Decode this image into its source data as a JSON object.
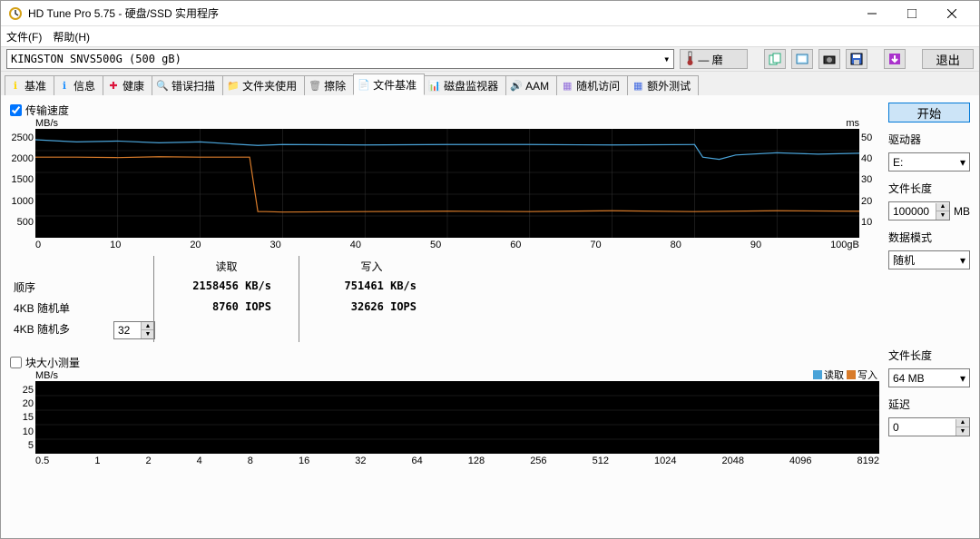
{
  "window": {
    "title": "HD Tune Pro 5.75 - 硬盘/SSD 实用程序"
  },
  "menu": {
    "file": "文件(F)",
    "help": "帮助(H)"
  },
  "toolbar": {
    "drive": "KINGSTON SNVS500G (500 gB)",
    "temp_dash": "— 磨",
    "exit": "退出"
  },
  "tabs": [
    {
      "label": "基准",
      "icon": "ℹ",
      "color": "#FFD700"
    },
    {
      "label": "信息",
      "icon": "ℹ",
      "color": "#1E90FF"
    },
    {
      "label": "健康",
      "icon": "✚",
      "color": "#DC143C"
    },
    {
      "label": "错误扫描",
      "icon": "🔍",
      "color": "#228B22"
    },
    {
      "label": "文件夹使用",
      "icon": "📁",
      "color": "#DAA520"
    },
    {
      "label": "擦除",
      "icon": "🗑",
      "color": "#808080"
    },
    {
      "label": "文件基准",
      "icon": "📄",
      "color": "#4169E1",
      "active": true
    },
    {
      "label": "磁盘监视器",
      "icon": "📊",
      "color": "#228B22"
    },
    {
      "label": "AAM",
      "icon": "🔊",
      "color": "#1E90FF"
    },
    {
      "label": "随机访问",
      "icon": "▦",
      "color": "#9370DB"
    },
    {
      "label": "额外测试",
      "icon": "▦",
      "color": "#4169E1"
    }
  ],
  "section1": {
    "chk": "传输速度",
    "unit_left": "MB/s",
    "unit_right": "ms",
    "read_hdr": "读取",
    "write_hdr": "写入",
    "rows": [
      {
        "label": "顺序",
        "spin": "",
        "read": "2158456 KB/s",
        "write": "751461 KB/s"
      },
      {
        "label": "4KB 随机单",
        "spin": "",
        "read": "8760 IOPS",
        "write": "32626 IOPS"
      },
      {
        "label": "4KB 随机多",
        "spin": "32",
        "read": "",
        "write": ""
      }
    ]
  },
  "section2": {
    "chk": "块大小测量",
    "unit": "MB/s",
    "legend_read": "读取",
    "legend_write": "写入"
  },
  "sidebar": {
    "start": "开始",
    "drive_label": "驱动器",
    "drive": "E:",
    "filelen_label": "文件长度",
    "filelen": "100000",
    "filelen_unit": "MB",
    "datamode_label": "数据模式",
    "datamode": "随机",
    "filelen2_label": "文件长度",
    "filelen2": "64 MB",
    "delay_label": "延迟",
    "delay": "0"
  },
  "chart_data": {
    "transfer": {
      "type": "line",
      "xlabel": "",
      "ylabel_left": "MB/s",
      "ylabel_right": "ms",
      "x_range": [
        0,
        100
      ],
      "x_unit": "gB",
      "y_left_ticks": [
        500,
        1000,
        1500,
        2000,
        2500
      ],
      "y_right_ticks": [
        10,
        20,
        30,
        40,
        50
      ],
      "x_ticks": [
        0,
        10,
        20,
        30,
        40,
        50,
        60,
        70,
        80,
        90,
        "100gB"
      ],
      "series": [
        {
          "name": "读取",
          "color": "#4aa3d8",
          "axis": "left",
          "approx": [
            [
              0,
              2250
            ],
            [
              5,
              2200
            ],
            [
              10,
              2220
            ],
            [
              15,
              2180
            ],
            [
              20,
              2200
            ],
            [
              25,
              2140
            ],
            [
              27,
              2120
            ],
            [
              30,
              2140
            ],
            [
              40,
              2130
            ],
            [
              50,
              2140
            ],
            [
              60,
              2140
            ],
            [
              70,
              2130
            ],
            [
              80,
              2140
            ],
            [
              81,
              1850
            ],
            [
              83,
              1800
            ],
            [
              85,
              1900
            ],
            [
              90,
              1950
            ],
            [
              95,
              1920
            ],
            [
              100,
              1940
            ]
          ]
        },
        {
          "name": "写入",
          "color": "#d87b2a",
          "axis": "left",
          "approx": [
            [
              0,
              1850
            ],
            [
              5,
              1850
            ],
            [
              10,
              1840
            ],
            [
              15,
              1860
            ],
            [
              20,
              1850
            ],
            [
              25,
              1850
            ],
            [
              26,
              1850
            ],
            [
              27,
              600
            ],
            [
              28,
              600
            ],
            [
              30,
              590
            ],
            [
              40,
              600
            ],
            [
              50,
              610
            ],
            [
              60,
              600
            ],
            [
              70,
              620
            ],
            [
              80,
              600
            ],
            [
              90,
              620
            ],
            [
              100,
              610
            ]
          ]
        }
      ]
    },
    "blocksize": {
      "type": "bar",
      "ylabel": "MB/s",
      "y_ticks": [
        5,
        10,
        15,
        20,
        25
      ],
      "x_ticks": [
        0.5,
        1,
        2,
        4,
        8,
        16,
        32,
        64,
        128,
        256,
        512,
        1024,
        2048,
        4096,
        8192
      ],
      "series": [
        {
          "name": "读取",
          "color": "#4aa3d8",
          "values": []
        },
        {
          "name": "写入",
          "color": "#d87b2a",
          "values": []
        }
      ]
    }
  }
}
